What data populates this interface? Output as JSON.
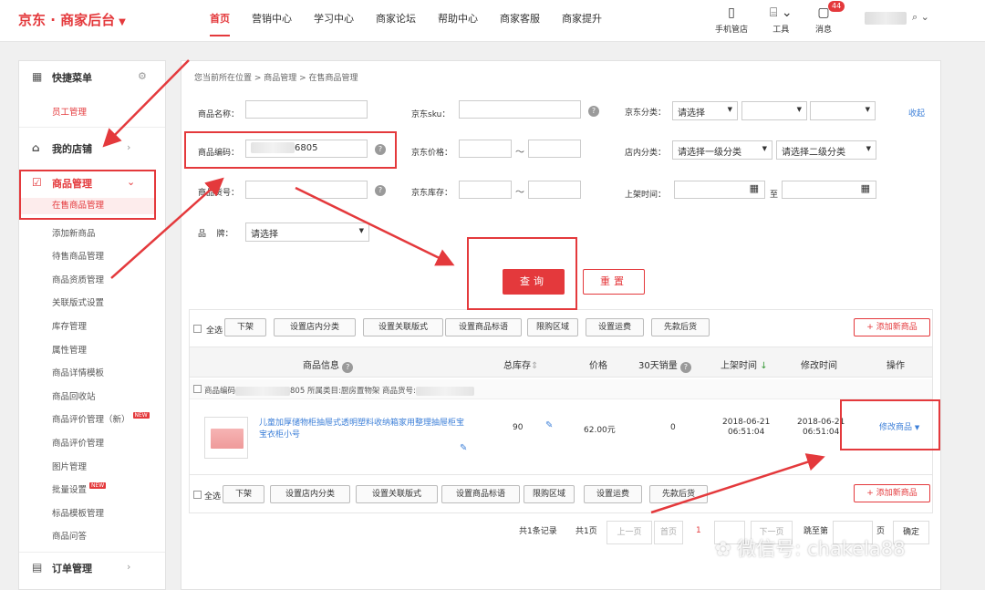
{
  "header": {
    "logo": "京东 · 商家后台",
    "nav": [
      "首页",
      "营销中心",
      "学习中心",
      "商家论坛",
      "帮助中心",
      "商家客服",
      "商家提升"
    ],
    "tools": {
      "phone": "手机管店",
      "tool": "工具",
      "message": "消息",
      "badge": "44"
    }
  },
  "sidebar": {
    "quick_menu": "快捷菜单",
    "quick_item": "员工管理",
    "my_store": "我的店铺",
    "product_mgmt": "商品管理",
    "product_items": [
      "在售商品管理",
      "添加新商品",
      "待售商品管理",
      "商品资质管理",
      "关联版式设置",
      "库存管理",
      "属性管理",
      "商品详情模板",
      "商品回收站",
      "商品评价管理（新）",
      "商品评价管理",
      "图片管理",
      "批量设置",
      "标品模板管理",
      "商品问答"
    ],
    "new_tag": "NEW",
    "order_mgmt": "订单管理"
  },
  "breadcrumb": "您当前所在位置 > 商品管理 > 在售商品管理",
  "filters": {
    "name_label": "商品名称：",
    "code_label": "商品编码：",
    "code_value_visible": "6805",
    "goods_no_label": "商品货号：",
    "brand_label": "品    牌：",
    "brand_value": "请选择",
    "sku_label": "京东sku：",
    "price_label": "京东价格：",
    "stock_label": "京东库存：",
    "jd_cat_label": "京东分类：",
    "jd_cat_value": "请选择",
    "store_cat_label": "店内分类：",
    "store_cat_1": "请选择一级分类",
    "store_cat_2": "请选择二级分类",
    "shelf_time_label": "上架时间：",
    "to_label": "至",
    "tilde": "～",
    "collapse": "收起"
  },
  "buttons": {
    "query": "查询",
    "reset": "重置"
  },
  "toolbar": {
    "select_all": "全选",
    "actions": [
      "下架",
      "设置店内分类",
      "设置关联版式",
      "设置商品标语",
      "限购区域",
      "设置运费",
      "先款后货"
    ],
    "add_new": "+ 添加新商品"
  },
  "table": {
    "headers": [
      "商品信息",
      "总库存",
      "价格",
      "30天销量",
      "上架时间",
      "修改时间",
      "操作"
    ],
    "row_meta": {
      "code_label": "商品编码",
      "code_suffix": "805",
      "category": "所属类目:厨房置物架",
      "goods_no": "商品货号:"
    },
    "row": {
      "title": "儿童加厚储物柜抽屉式透明塑料收纳箱家用整理抽屉柜宝宝衣柜小号",
      "stock": "90",
      "price": "62.00元",
      "sales": "0",
      "shelf_date": "2018-06-21",
      "shelf_time": "06:51:04",
      "modify_date": "2018-06-21",
      "modify_time": "06:51:04",
      "action": "修改商品"
    }
  },
  "pagination": {
    "total_records": "共1条记录",
    "total_pages": "共1页",
    "prev": "上一页",
    "first": "首页",
    "current": "1",
    "next": "下一页",
    "goto": "跳至第",
    "page_unit": "页",
    "confirm": "确定"
  },
  "watermark": "微信号: chakela88"
}
